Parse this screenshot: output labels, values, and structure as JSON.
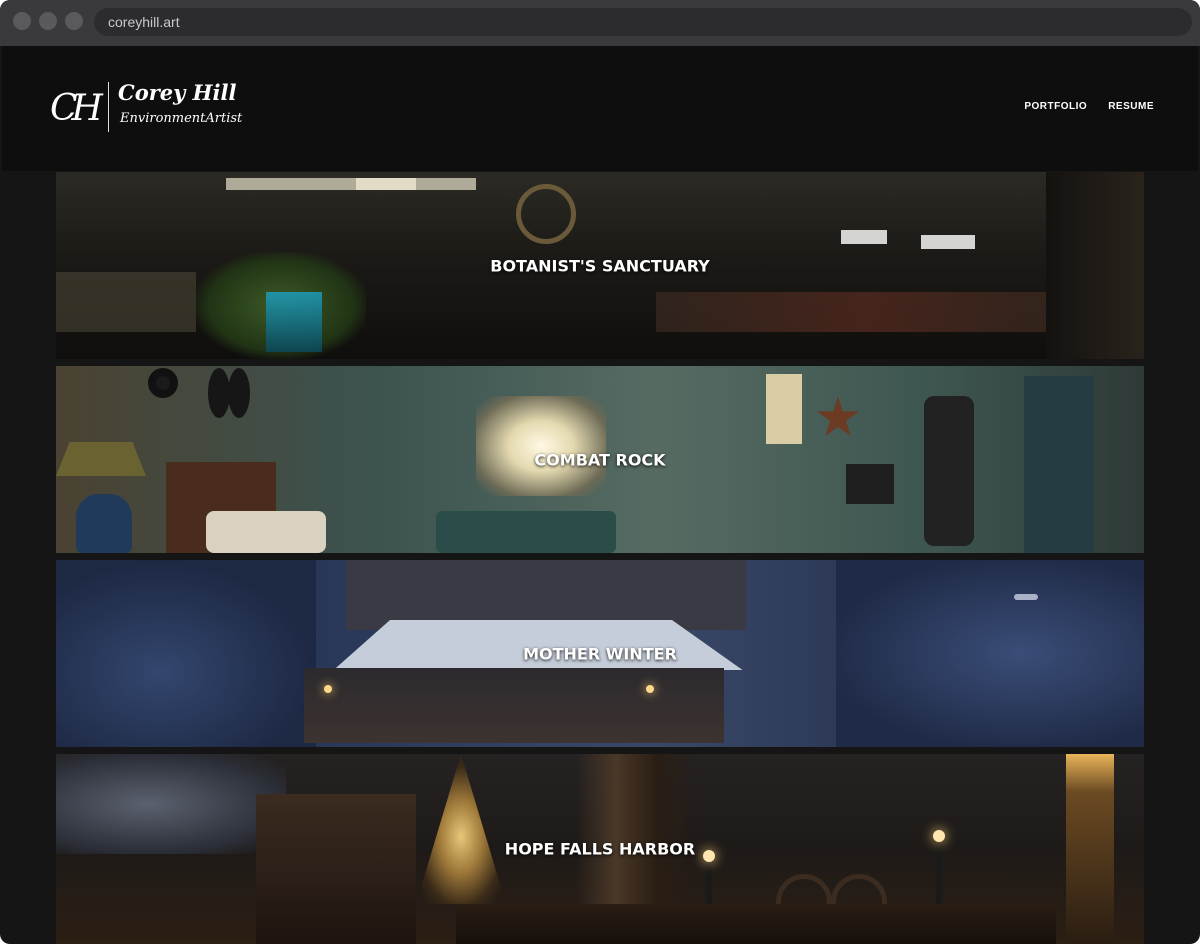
{
  "browser": {
    "url": "coreyhill.art"
  },
  "header": {
    "logo_monogram": "CH",
    "logo_name": "Corey  Hill",
    "logo_role": "EnvironmentArtist",
    "nav": [
      {
        "label": "PORTFOLIO"
      },
      {
        "label": "RESUME"
      }
    ]
  },
  "projects": [
    {
      "title": "BOTANIST'S SANCTUARY"
    },
    {
      "title": "COMBAT ROCK"
    },
    {
      "title": "MOTHER WINTER"
    },
    {
      "title": "HOPE FALLS HARBOR"
    }
  ],
  "colors": {
    "header_bg": "#0e0e0e",
    "page_bg": "#151515",
    "text": "#ffffff"
  }
}
